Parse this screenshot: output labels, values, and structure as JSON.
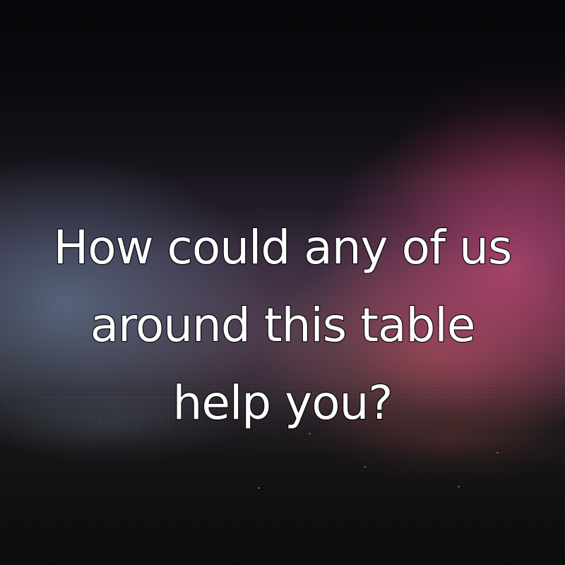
{
  "image": {
    "background_description": "",
    "colors": {
      "left_haze": "#7896b9",
      "right_haze": "#cd4b7d",
      "ground": "#1c1a1c",
      "text_fill": "#ffffff",
      "text_outline": "#000000"
    }
  },
  "quote": {
    "line1": "How could any of us",
    "line2": "around this table",
    "line3": "help you?"
  }
}
